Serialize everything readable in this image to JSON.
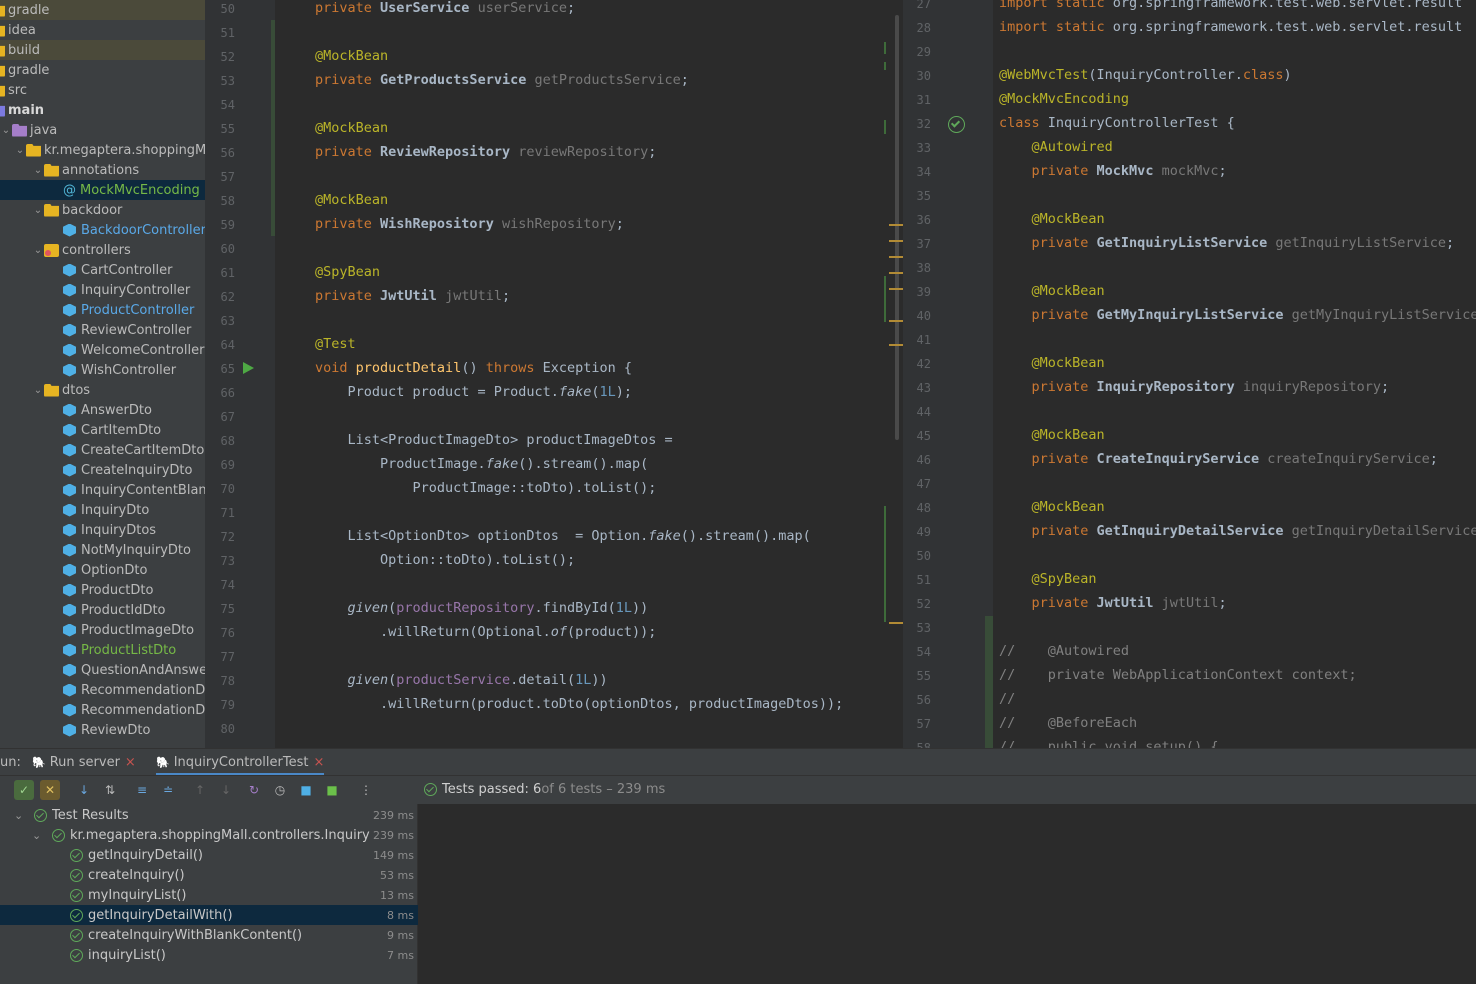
{
  "project_tree": [
    {
      "label": "gradle",
      "depth": 0,
      "icon": "folder-icon",
      "style": "hl"
    },
    {
      "label": "idea",
      "depth": 0,
      "icon": "folder-icon"
    },
    {
      "label": "build",
      "depth": 0,
      "icon": "folder-icon",
      "style": "hl"
    },
    {
      "label": "gradle",
      "depth": 0,
      "icon": "folder-icon"
    },
    {
      "label": "src",
      "depth": 0,
      "icon": "folder-icon"
    },
    {
      "label": "main",
      "depth": 0,
      "icon": "module-folder-icon",
      "bold": true
    },
    {
      "label": "java",
      "depth": 1,
      "icon": "source-folder-icon",
      "chev": "open"
    },
    {
      "label": "kr.megaptera.shoppingMall",
      "depth": 2,
      "icon": "package-icon",
      "chev": "open"
    },
    {
      "label": "annotations",
      "depth": 3,
      "icon": "package-icon",
      "chev": "open"
    },
    {
      "label": "MockMvcEncoding",
      "depth": 4,
      "icon": "annotation-icon",
      "color": "green",
      "style": "sel"
    },
    {
      "label": "backdoor",
      "depth": 3,
      "icon": "package-icon",
      "chev": "open"
    },
    {
      "label": "BackdoorController",
      "depth": 4,
      "icon": "class-icon",
      "color": "blue"
    },
    {
      "label": "controllers",
      "depth": 3,
      "icon": "test-package-icon",
      "chev": "open"
    },
    {
      "label": "CartController",
      "depth": 4,
      "icon": "class-icon"
    },
    {
      "label": "InquiryController",
      "depth": 4,
      "icon": "class-icon"
    },
    {
      "label": "ProductController",
      "depth": 4,
      "icon": "class-icon",
      "color": "blue"
    },
    {
      "label": "ReviewController",
      "depth": 4,
      "icon": "class-icon"
    },
    {
      "label": "WelcomeController",
      "depth": 4,
      "icon": "class-icon"
    },
    {
      "label": "WishController",
      "depth": 4,
      "icon": "class-icon"
    },
    {
      "label": "dtos",
      "depth": 3,
      "icon": "package-icon",
      "chev": "open"
    },
    {
      "label": "AnswerDto",
      "depth": 4,
      "icon": "class-icon"
    },
    {
      "label": "CartItemDto",
      "depth": 4,
      "icon": "class-icon"
    },
    {
      "label": "CreateCartItemDto",
      "depth": 4,
      "icon": "class-icon"
    },
    {
      "label": "CreateInquiryDto",
      "depth": 4,
      "icon": "class-icon"
    },
    {
      "label": "InquiryContentBlankException",
      "depth": 4,
      "icon": "class-icon"
    },
    {
      "label": "InquiryDto",
      "depth": 4,
      "icon": "class-icon"
    },
    {
      "label": "InquiryDtos",
      "depth": 4,
      "icon": "class-icon"
    },
    {
      "label": "NotMyInquiryDto",
      "depth": 4,
      "icon": "class-icon"
    },
    {
      "label": "OptionDto",
      "depth": 4,
      "icon": "class-icon"
    },
    {
      "label": "ProductDto",
      "depth": 4,
      "icon": "class-icon"
    },
    {
      "label": "ProductIdDto",
      "depth": 4,
      "icon": "class-icon"
    },
    {
      "label": "ProductImageDto",
      "depth": 4,
      "icon": "class-icon"
    },
    {
      "label": "ProductListDto",
      "depth": 4,
      "icon": "class-icon",
      "color": "green"
    },
    {
      "label": "QuestionAndAnswerDto",
      "depth": 4,
      "icon": "class-icon"
    },
    {
      "label": "RecommendationDto",
      "depth": 4,
      "icon": "class-icon"
    },
    {
      "label": "RecommendationDtos",
      "depth": 4,
      "icon": "class-icon"
    },
    {
      "label": "ReviewDto",
      "depth": 4,
      "icon": "class-icon"
    }
  ],
  "left_editor": {
    "line_numbers": [
      "50",
      "51",
      "52",
      "53",
      "54",
      "55",
      "56",
      "57",
      "58",
      "59",
      "60",
      "61",
      "62",
      "63",
      "64",
      "65",
      "66",
      "67",
      "68",
      "69",
      "70",
      "71",
      "72",
      "73",
      "74",
      "75",
      "76",
      "77",
      "78",
      "79",
      "80"
    ],
    "lines": [
      [
        [
          "kw",
          "private "
        ],
        [
          "ty",
          "UserService "
        ],
        [
          "gr",
          "userService"
        ],
        [
          "",
          "; "
        ]
      ],
      [],
      [
        [
          "an",
          "@MockBean"
        ]
      ],
      [
        [
          "kw",
          "private "
        ],
        [
          "ty",
          "GetProductsService "
        ],
        [
          "gr",
          "getProductsService"
        ],
        [
          "",
          ";"
        ]
      ],
      [],
      [
        [
          "an",
          "@MockBean"
        ]
      ],
      [
        [
          "kw",
          "private "
        ],
        [
          "ty",
          "ReviewRepository "
        ],
        [
          "gr",
          "reviewRepository"
        ],
        [
          "",
          ";"
        ]
      ],
      [],
      [
        [
          "an",
          "@MockBean"
        ]
      ],
      [
        [
          "kw",
          "private "
        ],
        [
          "ty",
          "WishRepository "
        ],
        [
          "gr",
          "wishRepository"
        ],
        [
          "",
          ";"
        ]
      ],
      [],
      [
        [
          "an",
          "@SpyBean"
        ]
      ],
      [
        [
          "kw",
          "private "
        ],
        [
          "ty",
          "JwtUtil "
        ],
        [
          "gr",
          "jwtUtil"
        ],
        [
          "",
          ";"
        ]
      ],
      [],
      [
        [
          "an",
          "@Test"
        ]
      ],
      [
        [
          "kw",
          "void "
        ],
        [
          "fn",
          "productDetail"
        ],
        [
          "",
          "() "
        ],
        [
          "kw",
          "throws "
        ],
        [
          "",
          "Exception {"
        ]
      ],
      [
        [
          "",
          "    Product product = Product."
        ],
        [
          "it",
          "fake"
        ],
        [
          "",
          "("
        ],
        [
          "nm",
          "1L"
        ],
        [
          "",
          ");"
        ]
      ],
      [],
      [
        [
          "",
          "    List<ProductImageDto> productImageDtos ="
        ]
      ],
      [
        [
          "",
          "        ProductImage."
        ],
        [
          "it",
          "fake"
        ],
        [
          "",
          "().stream().map("
        ]
      ],
      [
        [
          "",
          "            ProductImage::toDto).toList();"
        ]
      ],
      [],
      [
        [
          "",
          "    List<OptionDto> optionDtos  = Option."
        ],
        [
          "it",
          "fake"
        ],
        [
          "",
          "().stream().map("
        ]
      ],
      [
        [
          "",
          "        Option::toDto).toList();"
        ]
      ],
      [],
      [
        [
          "it",
          "    given"
        ],
        [
          "",
          "("
        ],
        [
          "fd",
          "productRepository"
        ],
        [
          "",
          ".findById("
        ],
        [
          "nm",
          "1L"
        ],
        [
          "",
          "))"
        ]
      ],
      [
        [
          "",
          "        .willReturn(Optional."
        ],
        [
          "it",
          "of"
        ],
        [
          "",
          "(product));"
        ]
      ],
      [],
      [
        [
          "it",
          "    given"
        ],
        [
          "",
          "("
        ],
        [
          "fd",
          "productService"
        ],
        [
          "",
          ".detail("
        ],
        [
          "nm",
          "1L"
        ],
        [
          "",
          "))"
        ]
      ],
      [
        [
          "",
          "        .willReturn(product.toDto(optionDtos, productImageDtos));"
        ]
      ],
      []
    ]
  },
  "right_editor": {
    "line_numbers": [
      "27",
      "28",
      "29",
      "30",
      "31",
      "32",
      "33",
      "34",
      "35",
      "36",
      "37",
      "38",
      "39",
      "40",
      "41",
      "42",
      "43",
      "44",
      "45",
      "46",
      "47",
      "48",
      "49",
      "50",
      "51",
      "52",
      "53",
      "54",
      "55",
      "56",
      "57",
      "58"
    ],
    "lines": [
      [
        [
          "kw",
          "import static "
        ],
        [
          "",
          "org.springframework.test.web.servlet.result"
        ]
      ],
      [
        [
          "kw",
          "import static "
        ],
        [
          "",
          "org.springframework.test.web.servlet.result"
        ]
      ],
      [],
      [
        [
          "an",
          "@WebMvcTest"
        ],
        [
          "",
          "(InquiryController."
        ],
        [
          "kw",
          "class"
        ],
        [
          "",
          ")"
        ]
      ],
      [
        [
          "an",
          "@MockMvcEncoding"
        ]
      ],
      [
        [
          "kw",
          "class "
        ],
        [
          "",
          "InquiryControllerTest {"
        ]
      ],
      [
        [
          "an",
          "    @Autowired"
        ]
      ],
      [
        [
          "kw",
          "    private "
        ],
        [
          "ty",
          "MockMvc "
        ],
        [
          "gr",
          "mockMvc"
        ],
        [
          "",
          ";"
        ]
      ],
      [],
      [
        [
          "an",
          "    @MockBean"
        ]
      ],
      [
        [
          "kw",
          "    private "
        ],
        [
          "ty",
          "GetInquiryListService "
        ],
        [
          "gr",
          "getInquiryListService"
        ],
        [
          "",
          ";"
        ]
      ],
      [],
      [
        [
          "an",
          "    @MockBean"
        ]
      ],
      [
        [
          "kw",
          "    private "
        ],
        [
          "ty",
          "GetMyInquiryListService "
        ],
        [
          "gr",
          "getMyInquiryListService"
        ]
      ],
      [],
      [
        [
          "an",
          "    @MockBean"
        ]
      ],
      [
        [
          "kw",
          "    private "
        ],
        [
          "ty",
          "InquiryRepository "
        ],
        [
          "gr",
          "inquiryRepository"
        ],
        [
          "",
          ";"
        ]
      ],
      [],
      [
        [
          "an",
          "    @MockBean"
        ]
      ],
      [
        [
          "kw",
          "    private "
        ],
        [
          "ty",
          "CreateInquiryService "
        ],
        [
          "gr",
          "createInquiryService"
        ],
        [
          "",
          ";"
        ]
      ],
      [],
      [
        [
          "an",
          "    @MockBean"
        ]
      ],
      [
        [
          "kw",
          "    private "
        ],
        [
          "ty",
          "GetInquiryDetailService "
        ],
        [
          "gr",
          "getInquiryDetailService"
        ]
      ],
      [],
      [
        [
          "an",
          "    @SpyBean"
        ]
      ],
      [
        [
          "kw",
          "    private "
        ],
        [
          "ty",
          "JwtUtil "
        ],
        [
          "gr",
          "jwtUtil"
        ],
        [
          "",
          ";"
        ]
      ],
      [],
      [
        [
          "cm",
          "//    @Autowired"
        ]
      ],
      [
        [
          "cm",
          "//    private WebApplicationContext context;"
        ]
      ],
      [
        [
          "cm",
          "//"
        ]
      ],
      [
        [
          "cm",
          "//    @BeforeEach"
        ]
      ],
      [
        [
          "cm",
          "//    public void setup() {"
        ]
      ]
    ]
  },
  "run_panel": {
    "prefix": "un:",
    "tabs": [
      {
        "label": "Run server"
      },
      {
        "label": "InquiryControllerTest",
        "active": true
      }
    ],
    "status_bold": "Tests passed: 6",
    "status_rest": " of 6 tests – 239 ms",
    "results": [
      {
        "label": "Test Results",
        "time": "239 ms",
        "depth": 0
      },
      {
        "label": "kr.megaptera.shoppingMall.controllers.InquiryControllerTest",
        "time": "239 ms",
        "depth": 1
      },
      {
        "label": "getInquiryDetail()",
        "time": "149 ms",
        "depth": 2
      },
      {
        "label": "createInquiry()",
        "time": "53 ms",
        "depth": 2
      },
      {
        "label": "myInquiryList()",
        "time": "13 ms",
        "depth": 2
      },
      {
        "label": "getInquiryDetailWith()",
        "time": "8 ms",
        "depth": 2,
        "selected": true
      },
      {
        "label": "createInquiryWithBlankContent()",
        "time": "9 ms",
        "depth": 2
      },
      {
        "label": "inquiryList()",
        "time": "7 ms",
        "depth": 2
      }
    ]
  },
  "colors": {
    "keyword": "#cc7832",
    "annotation": "#bbb529",
    "field": "#9876aa",
    "number": "#6897bb",
    "method": "#ffc66d",
    "pass": "#5fa85a"
  }
}
